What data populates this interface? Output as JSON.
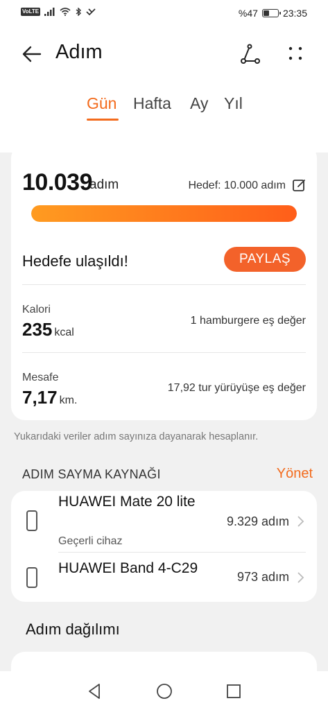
{
  "status_bar": {
    "network": "VoLTE",
    "battery_text": "%47",
    "battery_level": 0.47,
    "time": "23:35"
  },
  "header": {
    "title": "Adım",
    "icons": [
      "back-arrow-icon",
      "route-share-icon",
      "more-dots-icon"
    ]
  },
  "tabs": [
    {
      "label": "Gün",
      "active": true
    },
    {
      "label": "Hafta",
      "active": false
    },
    {
      "label": "Ay",
      "active": false
    },
    {
      "label": "Yıl",
      "active": false
    }
  ],
  "summary": {
    "steps": "10.039",
    "steps_unit": "adım",
    "goal_text": "Hedef: 10.000 adım",
    "progress": 1.0,
    "goal_reached": "Hedefe ulaşıldı!",
    "share_label": "PAYLAŞ",
    "calorie": {
      "label": "Kalori",
      "value": "235",
      "unit": "kcal",
      "equivalent": "1 hamburgere eş değer"
    },
    "distance": {
      "label": "Mesafe",
      "value": "7,17",
      "unit": "km.",
      "equivalent": "17,92 tur yürüyüşe eş değer"
    }
  },
  "note": "Yukarıdaki veriler adım sayınıza dayanarak hesaplanır.",
  "sources": {
    "title": "ADIM SAYMA KAYNAĞI",
    "manage_label": "Yönet",
    "devices": [
      {
        "name": "HUAWEI Mate 20 lite",
        "sub": "Geçerli cihaz",
        "steps": "9.329 adım"
      },
      {
        "name": "HUAWEI Band 4-C29",
        "sub": "",
        "steps": "973 adım"
      }
    ]
  },
  "distribution": {
    "title": "Adım dağılımı"
  },
  "colors": {
    "accent": "#f36b1d",
    "progress_start": "#ff9b20",
    "progress_end": "#ff5e1a",
    "share_button": "#f3622a"
  }
}
